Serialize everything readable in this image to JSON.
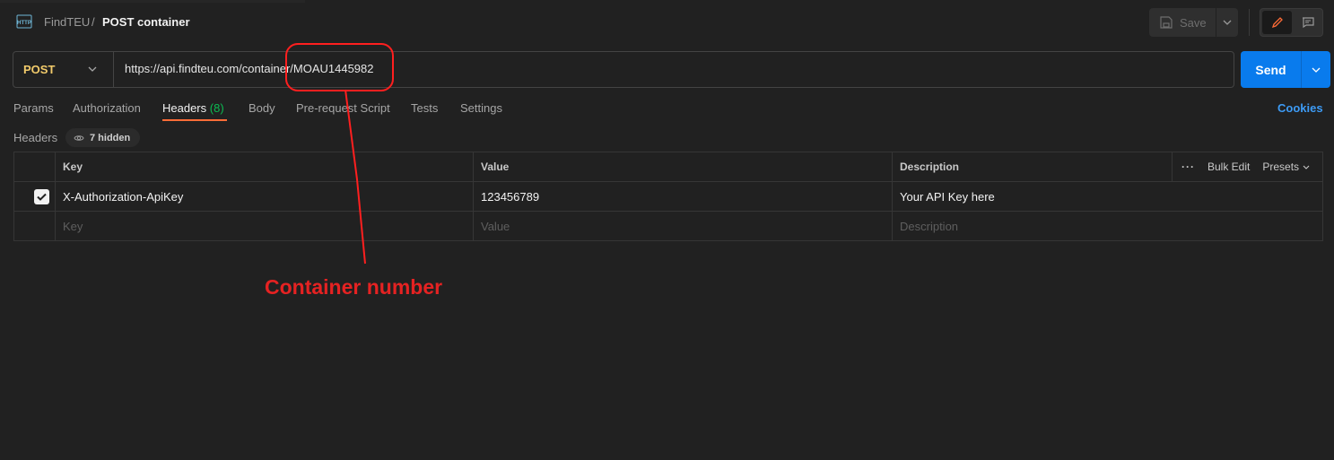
{
  "breadcrumb": {
    "parent": "FindTEU",
    "separator": "/",
    "title": "POST container",
    "icon": "http-icon"
  },
  "toolbar": {
    "save_label": "Save"
  },
  "request": {
    "method": "POST",
    "url": "https://api.findteu.com/container/MOAU1445982",
    "send_label": "Send"
  },
  "tabs": [
    {
      "label": "Params"
    },
    {
      "label": "Authorization"
    },
    {
      "label": "Headers",
      "count": "(8)",
      "active": true
    },
    {
      "label": "Body"
    },
    {
      "label": "Pre-request Script"
    },
    {
      "label": "Tests"
    },
    {
      "label": "Settings"
    }
  ],
  "cookies_label": "Cookies",
  "headers_section": {
    "label": "Headers",
    "hidden_label": "7 hidden"
  },
  "table": {
    "columns": [
      "Key",
      "Value",
      "Description"
    ],
    "actions": {
      "bulk_edit": "Bulk Edit",
      "presets": "Presets"
    },
    "rows": [
      {
        "checked": true,
        "key": "X-Authorization-ApiKey",
        "value": "123456789",
        "description": "Your API Key here"
      }
    ],
    "placeholder": {
      "key": "Key",
      "value": "Value",
      "description": "Description"
    }
  },
  "annotation": {
    "label": "Container number",
    "color": "#e52222"
  },
  "colors": {
    "accent": "#ff6c37",
    "send": "#097bed",
    "method": "#f2cb6b",
    "link": "#3d9bf5",
    "count": "#0cbb52"
  }
}
